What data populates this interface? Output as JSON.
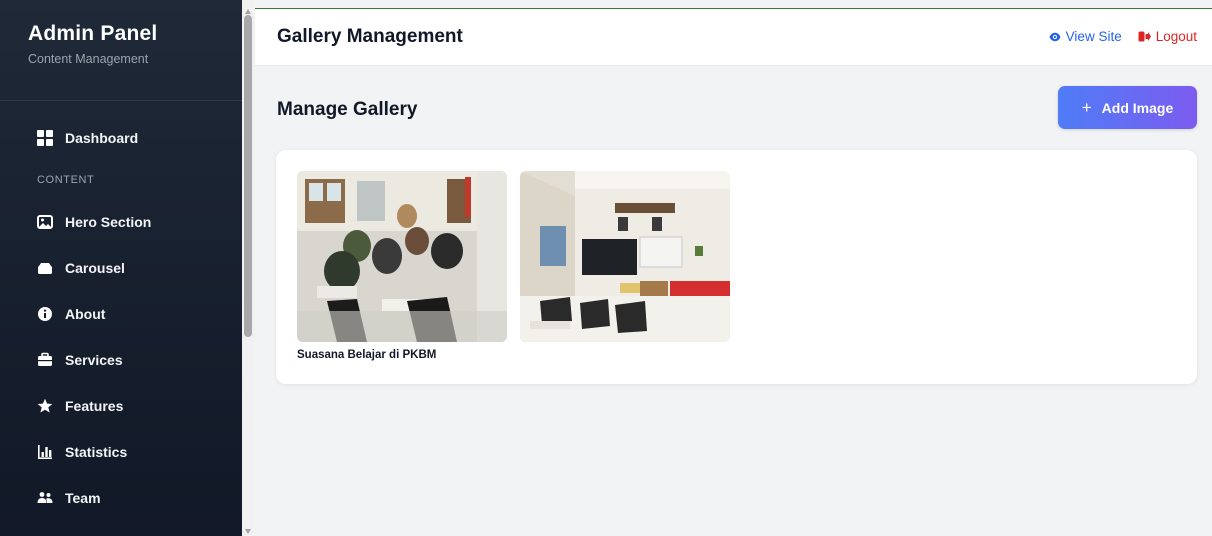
{
  "sidebar": {
    "brand_title": "Admin Panel",
    "brand_subtitle": "Content Management",
    "items": [
      {
        "label": "Dashboard",
        "icon": "grid-icon"
      },
      {
        "label": "CONTENT",
        "type": "section"
      },
      {
        "label": "Hero Section",
        "icon": "image-icon"
      },
      {
        "label": "Carousel",
        "icon": "carousel-icon"
      },
      {
        "label": "About",
        "icon": "info-icon"
      },
      {
        "label": "Services",
        "icon": "briefcase-icon"
      },
      {
        "label": "Features",
        "icon": "star-icon"
      },
      {
        "label": "Statistics",
        "icon": "bar-chart-icon"
      },
      {
        "label": "Team",
        "icon": "users-icon"
      }
    ]
  },
  "topbar": {
    "title": "Gallery Management",
    "view_site": "View Site",
    "logout": "Logout"
  },
  "main": {
    "page_title": "Manage Gallery",
    "add_button": "Add Image",
    "gallery": [
      {
        "caption": "Suasana Belajar di PKBM"
      },
      {
        "caption": ""
      }
    ]
  },
  "colors": {
    "sidebar_bg": "#1f2937",
    "link_blue": "#2563eb",
    "logout_red": "#dc2626",
    "button_gradient_start": "#4f7cf6",
    "button_gradient_end": "#7c5cf0"
  }
}
